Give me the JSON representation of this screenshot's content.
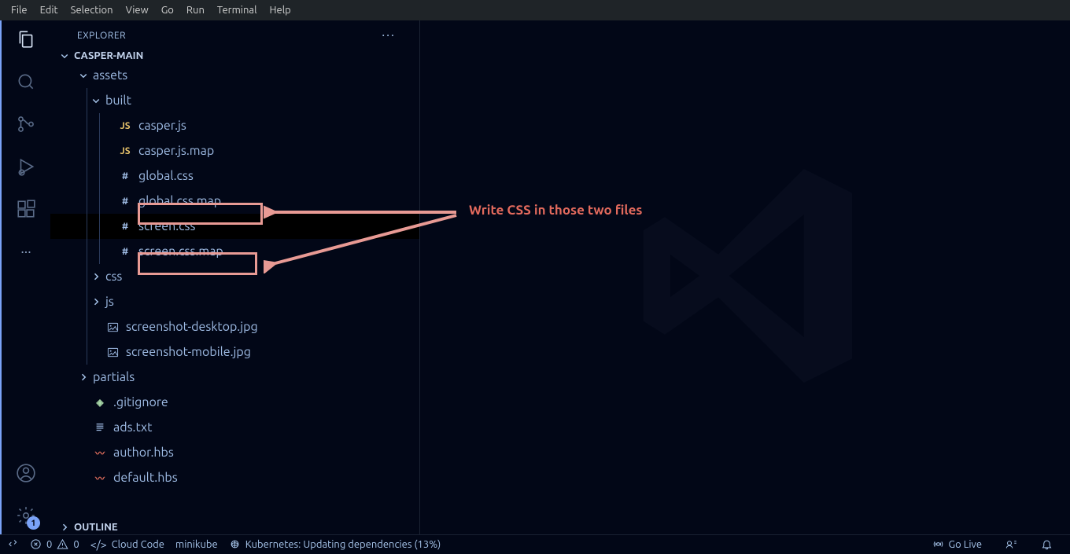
{
  "menubar": [
    "File",
    "Edit",
    "Selection",
    "View",
    "Go",
    "Run",
    "Terminal",
    "Help"
  ],
  "sidebar": {
    "title": "EXPLORER",
    "project": "CASPER-MAIN",
    "outline": "OUTLINE"
  },
  "tree": {
    "assets": "assets",
    "built": "built",
    "casperjs": "casper.js",
    "casperjsmap": "casper.js.map",
    "globalcss": "global.css",
    "globalcssmap": "global.css.map",
    "screencss": "screen.css",
    "screencssmap": "screen.css.map",
    "css": "css",
    "js": "js",
    "screenshot_desktop": "screenshot-desktop.jpg",
    "screenshot_mobile": "screenshot-mobile.jpg",
    "partials": "partials",
    "gitignore": ".gitignore",
    "adstxt": "ads.txt",
    "authorhbs": "author.hbs",
    "defaulthbs": "default.hbs"
  },
  "annotation": {
    "text": "Write CSS in those two files"
  },
  "status": {
    "errors": "0",
    "warnings": "0",
    "cloudcode": "Cloud Code",
    "minikube": "minikube",
    "kubernetes": "Kubernetes: Updating dependencies (13%)",
    "golive": "Go Live"
  },
  "badge": {
    "settings": "1"
  }
}
